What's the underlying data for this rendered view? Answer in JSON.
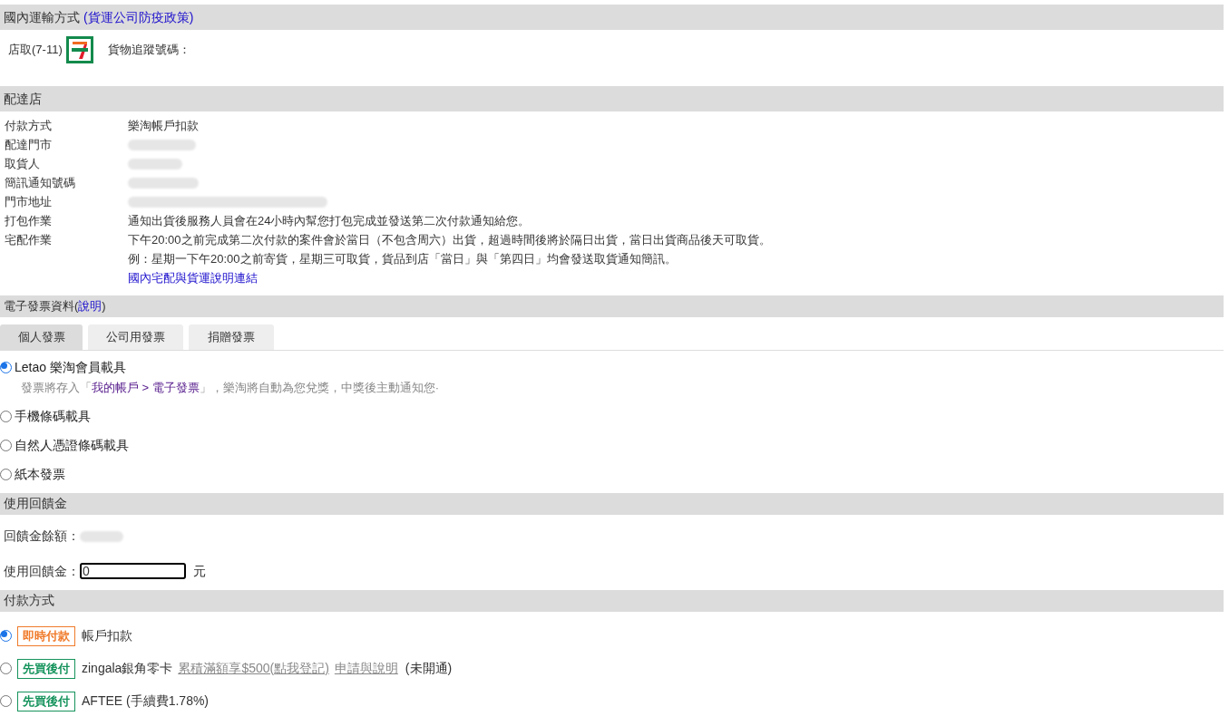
{
  "shipping": {
    "title": "國內運輸方式",
    "title_link": "(貨運公司防疫政策)",
    "method": "店取(7-11)",
    "tracking_label": "貨物追蹤號碼："
  },
  "store": {
    "title": "配達店",
    "rows": [
      {
        "label": "付款方式",
        "lines": [
          "樂淘帳戶扣款"
        ]
      },
      {
        "label": "配達門市",
        "redacted": true
      },
      {
        "label": "取貨人",
        "redacted": true
      },
      {
        "label": "簡訊通知號碼",
        "redacted": true
      },
      {
        "label": "門市地址",
        "redacted": true
      },
      {
        "label": "打包作業",
        "lines": [
          "通知出貨後服務人員會在24小時內幫您打包完成並發送第二次付款通知給您。"
        ]
      },
      {
        "label": "宅配作業",
        "lines": [
          "下午20:00之前完成第二次付款的案件會於當日（不包含周六）出貨，超過時間後將於隔日出貨，當日出貨商品後天可取貨。",
          "例：星期一下午20:00之前寄貨，星期三可取貨，貨品到店「當日」與「第四日」均會發送取貨通知簡訊。"
        ],
        "link": "國內宅配與貨運說明連結"
      }
    ]
  },
  "invoice": {
    "title": "電子發票資料(",
    "title_link": "說明",
    "title_end": ")",
    "tabs": [
      {
        "label": "個人發票",
        "selected": true
      },
      {
        "label": "公司用發票",
        "selected": false
      },
      {
        "label": "捐贈發票",
        "selected": false
      }
    ],
    "options": [
      {
        "label": "Letao 樂淘會員載具",
        "selected": true,
        "note_before": "發票將存入「",
        "note_link": "我的帳戶 > 電子發票",
        "note_after": "」，樂淘將自動為您兌獎，中獎後主動通知您·"
      },
      {
        "label": "手機條碼載具",
        "selected": false
      },
      {
        "label": "自然人憑證條碼載具",
        "selected": false
      },
      {
        "label": "紙本發票",
        "selected": false
      }
    ]
  },
  "rebate": {
    "title": "使用回饋金",
    "balance_label": "回饋金餘額：",
    "balance_redacted": true,
    "use_label": "使用回饋金：",
    "use_value": "0",
    "unit": "元"
  },
  "payment": {
    "title": "付款方式",
    "options": [
      {
        "kind": "instant",
        "badge": "即時付款",
        "selected": true,
        "text": "帳戶扣款"
      },
      {
        "kind": "bnpl",
        "badge": "先買後付",
        "selected": false,
        "text": "zingala銀角零卡",
        "links": [
          "累積滿額享$500(點我登記)",
          "申請與說明"
        ],
        "note": "(未開通)"
      },
      {
        "kind": "bnpl",
        "badge": "先買後付",
        "selected": false,
        "text": "AFTEE (手續費1.78%)"
      }
    ]
  }
}
